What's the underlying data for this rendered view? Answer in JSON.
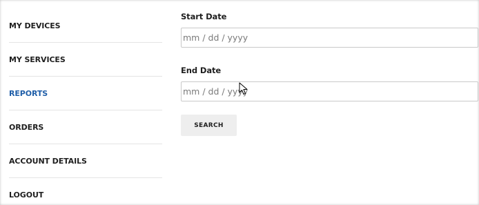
{
  "sidebar": {
    "items": [
      {
        "label": "MY DEVICES"
      },
      {
        "label": "MY SERVICES"
      },
      {
        "label": "REPORTS"
      },
      {
        "label": "ORDERS"
      },
      {
        "label": "ACCOUNT DETAILS"
      },
      {
        "label": "LOGOUT"
      }
    ],
    "active_color": "#1f5ea8"
  },
  "form": {
    "start_date": {
      "label": "Start Date",
      "placeholder": "mm / dd / yyyy"
    },
    "end_date": {
      "label": "End Date",
      "placeholder": "mm / dd / yyyy"
    },
    "search_label": "SEARCH"
  }
}
